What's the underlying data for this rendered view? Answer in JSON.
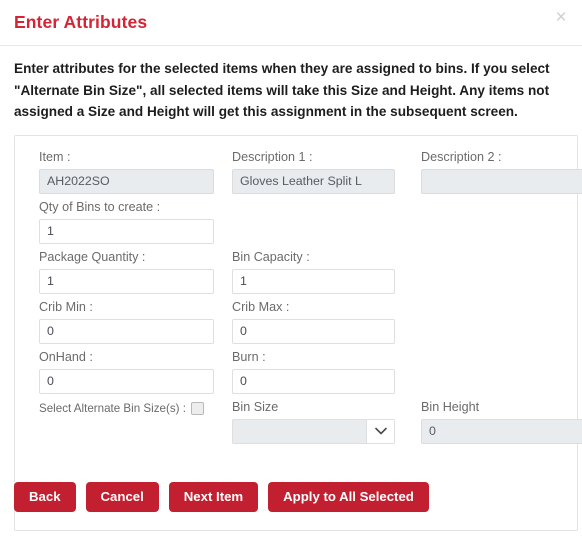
{
  "header": {
    "title": "Enter Attributes",
    "close_icon": "close-icon",
    "close_glyph": "×"
  },
  "intro": {
    "text": "Enter attributes for the selected items when they are assigned to bins. If you select \"Alternate Bin Size\", all selected items will take this Size and Height. Any items not assigned a Size and Height will get this assignment in the subsequent screen."
  },
  "form": {
    "item": {
      "label": "Item :",
      "value": "AH2022SO",
      "placeholder": ""
    },
    "description1": {
      "label": "Description 1 :",
      "value": "Gloves Leather Split L",
      "placeholder": ""
    },
    "description2": {
      "label": "Description 2 :",
      "value": "",
      "placeholder": ""
    },
    "qty_of_bins": {
      "label": "Qty of Bins to create :",
      "value": "1",
      "placeholder": ""
    },
    "package_quantity": {
      "label": "Package Quantity :",
      "value": "1",
      "placeholder": ""
    },
    "bin_capacity": {
      "label": "Bin Capacity :",
      "value": "1",
      "placeholder": ""
    },
    "crib_min": {
      "label": "Crib Min :",
      "value": "0",
      "placeholder": ""
    },
    "crib_max": {
      "label": "Crib Max :",
      "value": "0",
      "placeholder": ""
    },
    "onhand": {
      "label": "OnHand :",
      "value": "0",
      "placeholder": ""
    },
    "burn": {
      "label": "Burn :",
      "value": "0",
      "placeholder": ""
    },
    "alternate_bin_size": {
      "label": "Select Alternate Bin Size(s) :",
      "checked": false
    },
    "bin_size": {
      "label": "Bin Size",
      "value": "",
      "arrow_icon": "chevron-down-icon"
    },
    "bin_height": {
      "label": "Bin Height",
      "value": "0",
      "placeholder": ""
    }
  },
  "buttons": {
    "back": "Back",
    "cancel": "Cancel",
    "next_item": "Next Item",
    "apply_all": "Apply to All Selected"
  },
  "colors": {
    "accent_red": "#d32535",
    "button_red": "#c22030",
    "disabled_bg": "#e9ecef",
    "border": "#dfdfdf",
    "label_text": "#6b6b6b"
  }
}
